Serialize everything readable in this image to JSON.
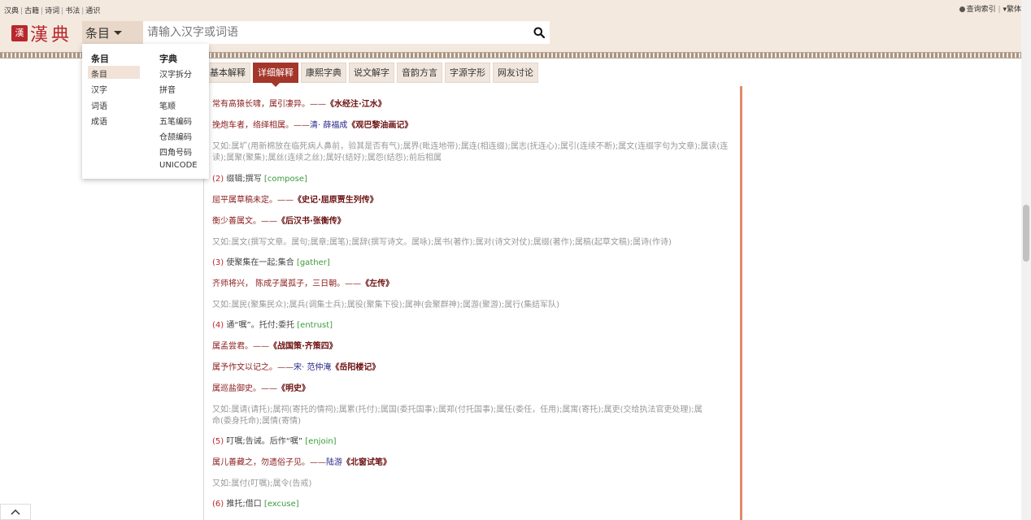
{
  "top_links": [
    "汉典",
    "古籍",
    "诗词",
    "书法",
    "通识"
  ],
  "top_right": {
    "index": "查询索引",
    "traditional": "繁体"
  },
  "logo": {
    "seal": "漢",
    "text": "漢典"
  },
  "search": {
    "category": "条目",
    "placeholder": "请输入汉字或词语"
  },
  "dropdown": {
    "col1_head": "条目",
    "col1": [
      "条目",
      "汉字",
      "词语",
      "成语"
    ],
    "col2_head": "字典",
    "col2": [
      "汉字拆分",
      "拼音",
      "笔顺",
      "五笔编码",
      "仓颉编码",
      "四角号码",
      "UNICODE"
    ]
  },
  "tabs": [
    "基本解释",
    "详细解释",
    "康熙字典",
    "说文解字",
    "音韵方言",
    "字源字形",
    "网友讨论"
  ],
  "active_tab": "详细解释",
  "content": {
    "l1": {
      "text": "常有高猿长啸，属引凄异。——",
      "src": "《水经注·江水》"
    },
    "l2": {
      "text": "挽炮车者，络绎相属。——",
      "auth": "清· 薛福成",
      "src": "《观巴黎油画记》"
    },
    "l3": "又如:属圹(用新棉放在临死病人鼻前，验其是否有气);属界(毗连地带);属连(相连缀);属志(抚连心);属引(连续不断);属文(连缀字句为文章);属读(连读);属聚(聚集);属丝(连续之丝);属好(结好);属怨(结怨);前后相属",
    "d2": {
      "num": "(2)",
      "text": "缀辑;撰写",
      "en": "[compose]"
    },
    "l4": {
      "text": "屈平属草稿未定。——",
      "src": "《史记·屈原贾生列传》"
    },
    "l5": {
      "text": "衡少善属文。——",
      "src": "《后汉书·张衡传》"
    },
    "l6": "又如:属文(撰写文章。属句;属章;属笔);属辞(撰写诗文。属咏);属书(著作);属对(诗文对仗);属缀(著作);属稿(起草文稿);属诗(作诗)",
    "d3": {
      "num": "(3)",
      "text": "使聚集在一起;集合",
      "en": "[gather]"
    },
    "l7": {
      "text": "齐师将兴， 陈成子属孤子，三日朝。——",
      "src": "《左传》"
    },
    "l8": "又如:属民(聚集民众);属兵(调集士兵);属役(聚集下役);属神(会聚群神);属游(聚游);属行(集结军队)",
    "d4": {
      "num": "(4)",
      "text": "通“嘱”。托付;委托",
      "en": "[entrust]"
    },
    "l9": {
      "text": "属孟尝君。——",
      "src": "《战国策·齐策四》"
    },
    "l10": {
      "text": "属予作文以记之。——",
      "auth": "宋· 范仲淹",
      "src": "《岳阳楼记》"
    },
    "l11": {
      "text": "属巡盐御史。——",
      "src": "《明史》"
    },
    "l12a": "又如:属请(请托);属祠(寄托的情祠);属累(托付);属国(委托国事);属郑(付托国事);属任(委任，任用);属寓(寄托);属吏(交给执法官吏处理);属",
    "l12b": "命(委身托命);属情(寄情)",
    "d5": {
      "num": "(5)",
      "text": "叮嘱;告诫。后作“嘱” ",
      "en": "[enjoin]"
    },
    "l13": {
      "text": "属儿善藏之，勿遗俗子见。——",
      "auth": "陆游",
      "src": "《北窗试笔》"
    },
    "l14": "又如:属付(叮嘱);属令(告戒)",
    "d6": {
      "num": "(6)",
      "text": "推托;借口",
      "en": "[excuse]"
    }
  }
}
